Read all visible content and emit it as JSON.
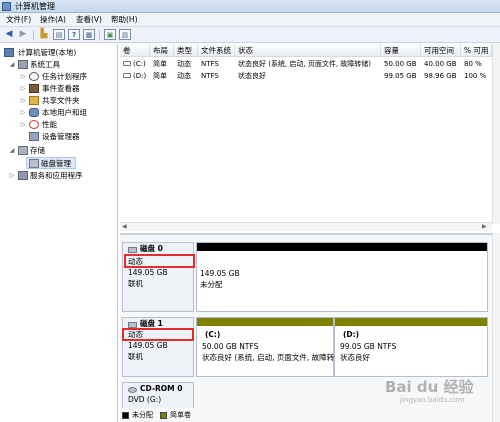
{
  "window": {
    "title": "计算机管理"
  },
  "menu": [
    "文件(F)",
    "操作(A)",
    "查看(V)",
    "帮助(H)"
  ],
  "toolbar": {
    "icons": [
      "back-arrow-icon",
      "forward-arrow-icon",
      "up-folder-icon",
      "show-hide-tree-icon",
      "help-icon",
      "properties-icon",
      "export-icon",
      "settings-icon"
    ],
    "help_glyph": "?"
  },
  "tree": {
    "root": "计算机管理(本地)",
    "system_tools": "系统工具",
    "items": [
      "任务计划程序",
      "事件查看器",
      "共享文件夹",
      "本地用户和组",
      "性能",
      "设备管理器"
    ],
    "storage": "存储",
    "disk_management": "磁盘管理",
    "services": "服务和应用程序"
  },
  "volume_table": {
    "headers": [
      "卷",
      "布局",
      "类型",
      "文件系统",
      "状态",
      "容量",
      "可用空间",
      "% 可用"
    ],
    "rows": [
      [
        "(C:)",
        "简单",
        "动态",
        "NTFS",
        "状态良好 (系统, 启动, 页面文件, 故障转储)",
        "50.00 GB",
        "40.00 GB",
        "80 %"
      ],
      [
        "(D:)",
        "简单",
        "动态",
        "NTFS",
        "状态良好",
        "99.05 GB",
        "98.96 GB",
        "100 %"
      ]
    ]
  },
  "disks": [
    {
      "name": "磁盘 0",
      "type": "动态",
      "size": "149.05 GB",
      "status": "联机",
      "partition": {
        "size": "149.05 GB",
        "label": "未分配"
      }
    },
    {
      "name": "磁盘 1",
      "type": "动态",
      "size": "149.05 GB",
      "status": "联机",
      "partitions": [
        {
          "drive": "(C:)",
          "detail": "50.00 GB NTFS",
          "status": "状态良好 (系统, 启动, 页面文件, 故障转储"
        },
        {
          "drive": "(D:)",
          "detail": "99.05 GB NTFS",
          "status": "状态良好"
        }
      ]
    },
    {
      "name": "CD-ROM 0",
      "type": "DVD (G:)"
    }
  ],
  "legend": {
    "unallocated": "未分配",
    "simple_volume": "简单卷"
  },
  "colors": {
    "unallocated": "#000000",
    "simple_volume": "#7f7f00",
    "highlight": "#e22b2b"
  },
  "watermark": {
    "text": "Bai du 经验",
    "sub": "jingyan.baidu.com"
  }
}
